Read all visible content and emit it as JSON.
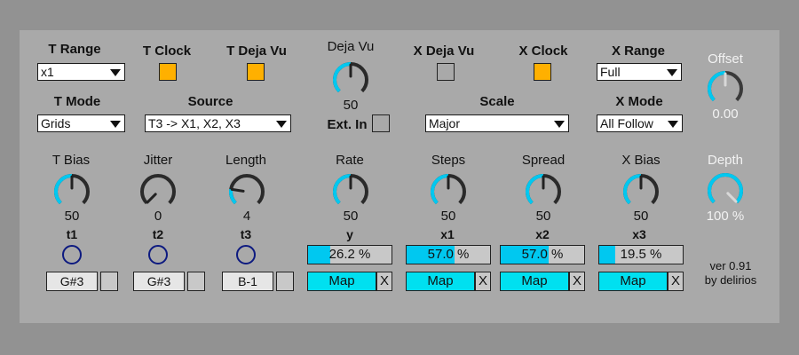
{
  "colors": {
    "accent": "#00c8f0",
    "toggle_on": "#ffb000",
    "ring": "#0d1a80",
    "map": "#00e0f0"
  },
  "t_range": {
    "label": "T Range",
    "value": "x1"
  },
  "t_clock": {
    "label": "T Clock",
    "on": true
  },
  "t_deja_vu": {
    "label": "T Deja Vu",
    "on": true
  },
  "deja_vu": {
    "label": "Deja Vu",
    "value": "50",
    "level": 0.5
  },
  "ext_in": {
    "label": "Ext. In",
    "on": false
  },
  "x_deja_vu": {
    "label": "X Deja Vu",
    "on": false
  },
  "x_clock": {
    "label": "X Clock",
    "on": true
  },
  "x_range": {
    "label": "X Range",
    "value": "Full"
  },
  "offset": {
    "label": "Offset",
    "value": "0.00",
    "level": 0.5
  },
  "t_mode": {
    "label": "T Mode",
    "value": "Grids"
  },
  "source": {
    "label": "Source",
    "value": "T3 -> X1, X2, X3"
  },
  "scale": {
    "label": "Scale",
    "value": "Major"
  },
  "x_mode": {
    "label": "X Mode",
    "value": "All Follow"
  },
  "depth": {
    "label": "Depth",
    "value": "100 %",
    "level": 1.0
  },
  "knobs": [
    {
      "label": "T Bias",
      "value": "50",
      "level": 0.5
    },
    {
      "label": "Jitter",
      "value": "0",
      "level": 0.0
    },
    {
      "label": "Length",
      "value": "4",
      "level": 0.2
    },
    {
      "label": "Rate",
      "value": "50",
      "level": 0.5
    },
    {
      "label": "Steps",
      "value": "50",
      "level": 0.5
    },
    {
      "label": "Spread",
      "value": "50",
      "level": 0.5
    },
    {
      "label": "X Bias",
      "value": "50",
      "level": 0.5
    }
  ],
  "t_outputs": [
    {
      "label": "t1",
      "note": "G#3"
    },
    {
      "label": "t2",
      "note": "G#3"
    },
    {
      "label": "t3",
      "note": "B-1"
    }
  ],
  "x_outputs": [
    {
      "label": "y",
      "percent": "26.2 %",
      "level": 0.262,
      "map": "Map",
      "x": "X"
    },
    {
      "label": "x1",
      "percent": "57.0 %",
      "level": 0.57,
      "map": "Map",
      "x": "X"
    },
    {
      "label": "x2",
      "percent": "57.0 %",
      "level": 0.57,
      "map": "Map",
      "x": "X"
    },
    {
      "label": "x3",
      "percent": "19.5 %",
      "level": 0.195,
      "map": "Map",
      "x": "X"
    }
  ],
  "version": {
    "line1": "ver 0.91",
    "line2": "by delirios"
  }
}
